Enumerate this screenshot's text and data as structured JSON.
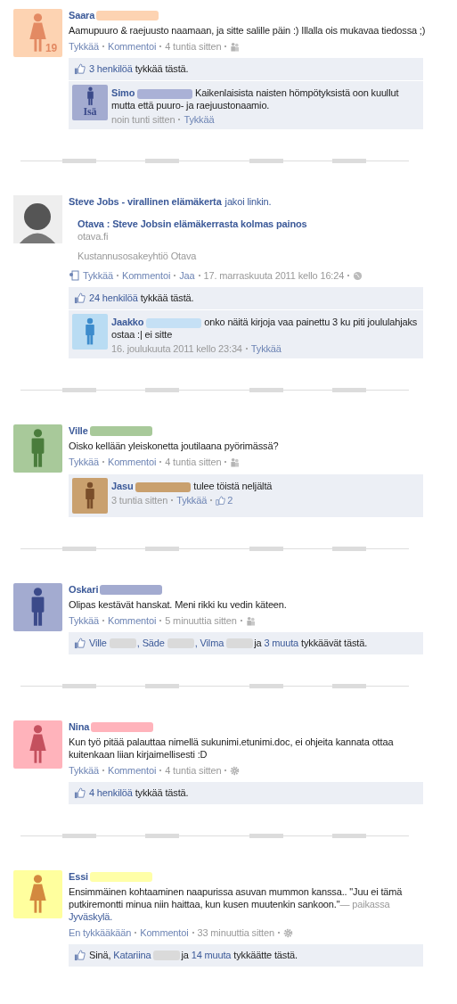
{
  "posts": [
    {
      "avatar": {
        "kind": "woman",
        "color": "#fdd3b2",
        "figure": {
          "color": "#e38a63"
        },
        "badge": "19"
      },
      "author": "Saara",
      "name_mask": {
        "color": "#fdd3b2"
      },
      "text": "Aamupuuro & raejuusto naamaan, ja sitte salille päin :) Illalla ois mukavaa tiedossa ;)",
      "actions": [
        {
          "text": "Tykkää",
          "kind": "link"
        },
        {
          "text": "Kommentoi",
          "kind": "link"
        },
        {
          "text": "4 tuntia sitten",
          "kind": "meta"
        }
      ],
      "audience": {
        "kind": "friends"
      },
      "likes": [
        {
          "text": "3 henkilöä",
          "kind": "link"
        },
        {
          "text": "tykkää tästä.",
          "kind": "plain"
        }
      ],
      "comments": [
        {
          "avatar": {
            "kind": "man",
            "color": "#a3abd0",
            "figure": {
              "color": "#3b4a8a"
            },
            "badge": "Isä"
          },
          "author": "Simo",
          "name_mask": {
            "color": "#aab1d6"
          },
          "text": "Kaikenlaisista naisten hömpötyksistä oon kuullut mutta että puuro- ja raejuustonaamio.",
          "meta": [
            {
              "text": "noin tunti sitten",
              "kind": "meta"
            },
            {
              "text": "Tykkää",
              "kind": "link"
            }
          ]
        }
      ]
    },
    {
      "avatar": {
        "kind": "photo"
      },
      "author": "Steve Jobs - virallinen elämäkerta",
      "action_text": "jakoi linkin.",
      "link": {
        "title": "Otava : Steve Jobsin elämäkerrasta kolmas painos",
        "domain": "otava.fi",
        "source": "Kustannusosakeyhtiö Otava"
      },
      "share_icon": true,
      "actions": [
        {
          "text": "Tykkää",
          "kind": "link"
        },
        {
          "text": "Kommentoi",
          "kind": "link"
        },
        {
          "text": "Jaa",
          "kind": "link"
        },
        {
          "text": "17. marraskuuta 2011 kello 16:24",
          "kind": "meta"
        }
      ],
      "audience": {
        "kind": "globe"
      },
      "likes": [
        {
          "text": "24 henkilöä",
          "kind": "link"
        },
        {
          "text": "tykkää tästä.",
          "kind": "plain"
        }
      ],
      "comments": [
        {
          "avatar": {
            "kind": "man",
            "color": "#b9dcf3",
            "figure": {
              "color": "#3d8ccc"
            }
          },
          "author": "Jaakko",
          "name_mask": {
            "color": "#c5e0f5"
          },
          "text": "onko näitä kirjoja vaa painettu 3 ku piti joululahjaks ostaa :| ei sitte",
          "meta": [
            {
              "text": "16. joulukuuta 2011 kello 23:34",
              "kind": "meta"
            },
            {
              "text": "Tykkää",
              "kind": "link"
            }
          ]
        }
      ]
    },
    {
      "avatar": {
        "kind": "man",
        "color": "#a8c99a",
        "figure": {
          "color": "#4a7c3c"
        }
      },
      "author": "Ville",
      "name_mask": {
        "color": "#a8c99a"
      },
      "text": "Oisko kellään yleiskonetta joutilaana pyörimässä?",
      "actions": [
        {
          "text": "Tykkää",
          "kind": "link"
        },
        {
          "text": "Kommentoi",
          "kind": "link"
        },
        {
          "text": "4 tuntia sitten",
          "kind": "meta"
        }
      ],
      "audience": {
        "kind": "friends"
      },
      "comments": [
        {
          "avatar": {
            "kind": "man",
            "color": "#c9a06e",
            "figure": {
              "color": "#7a4e2a"
            }
          },
          "author": "Jasu",
          "name_mask": {
            "color": "#c9a06e"
          },
          "text": "tulee töistä neljältä",
          "meta": [
            {
              "text": "3 tuntia sitten",
              "kind": "meta"
            },
            {
              "text": "Tykkää",
              "kind": "link"
            },
            {
              "text": "2",
              "kind": "likes"
            }
          ]
        }
      ]
    },
    {
      "avatar": {
        "kind": "man",
        "color": "#a3abd0",
        "figure": {
          "color": "#3b4a8a"
        }
      },
      "author": "Oskari",
      "name_mask": {
        "color": "#a3abd0"
      },
      "text": "Olipas kestävät hanskat. Meni rikki ku vedin käteen.",
      "actions": [
        {
          "text": "Tykkää",
          "kind": "link"
        },
        {
          "text": "Kommentoi",
          "kind": "link"
        },
        {
          "text": "5 minuuttia sitten",
          "kind": "meta"
        }
      ],
      "audience": {
        "kind": "friends"
      },
      "likes": [
        {
          "text": "Ville",
          "kind": "link"
        },
        {
          "kind": "mask"
        },
        {
          "text": ", Säde",
          "kind": "link"
        },
        {
          "kind": "mask"
        },
        {
          "text": ", Vilma",
          "kind": "link"
        },
        {
          "kind": "mask"
        },
        {
          "text": "ja",
          "kind": "plain"
        },
        {
          "text": "3 muuta",
          "kind": "link"
        },
        {
          "text": "tykkäävät tästä.",
          "kind": "plain"
        }
      ]
    },
    {
      "avatar": {
        "kind": "woman",
        "color": "#ffb3bb",
        "figure": {
          "color": "#c4505e"
        }
      },
      "author": "Nina",
      "name_mask": {
        "color": "#ffb3bb"
      },
      "text": "Kun työ pitää palauttaa nimellä sukunimi.etunimi.doc, ei ohjeita kannata ottaa kuitenkaan liian kirjaimellisesti :D",
      "actions": [
        {
          "text": "Tykkää",
          "kind": "link"
        },
        {
          "text": "Kommentoi",
          "kind": "link"
        },
        {
          "text": "4 tuntia sitten",
          "kind": "meta"
        }
      ],
      "audience": {
        "kind": "gear"
      },
      "likes": [
        {
          "text": "4 henkilöä",
          "kind": "link"
        },
        {
          "text": "tykkää tästä.",
          "kind": "plain"
        }
      ]
    },
    {
      "avatar": {
        "kind": "woman",
        "color": "#ffff9e",
        "figure": {
          "color": "#d3893f"
        }
      },
      "author": "Essi",
      "name_mask": {
        "color": "#ffffa8"
      },
      "text": "Ensimmäinen kohtaaminen naapurissa asuvan mummon kanssa.. \"Juu ei tämä putkiremontti minua niin haittaa, kun kusen muutenkin sankoon.\"",
      "location": {
        "prefix": "— paikassa",
        "place": "Jyväskylä."
      },
      "actions": [
        {
          "text": "En tykkääkään",
          "kind": "link"
        },
        {
          "text": "Kommentoi",
          "kind": "link"
        },
        {
          "text": "33 minuuttia sitten",
          "kind": "meta"
        }
      ],
      "audience": {
        "kind": "gear"
      },
      "likes": [
        {
          "text": "Sinä,",
          "kind": "plain"
        },
        {
          "text": "Katariina",
          "kind": "link"
        },
        {
          "kind": "mask"
        },
        {
          "text": "ja",
          "kind": "plain"
        },
        {
          "text": "14 muuta",
          "kind": "link"
        },
        {
          "text": "tykkäätte tästä.",
          "kind": "plain"
        }
      ]
    }
  ]
}
